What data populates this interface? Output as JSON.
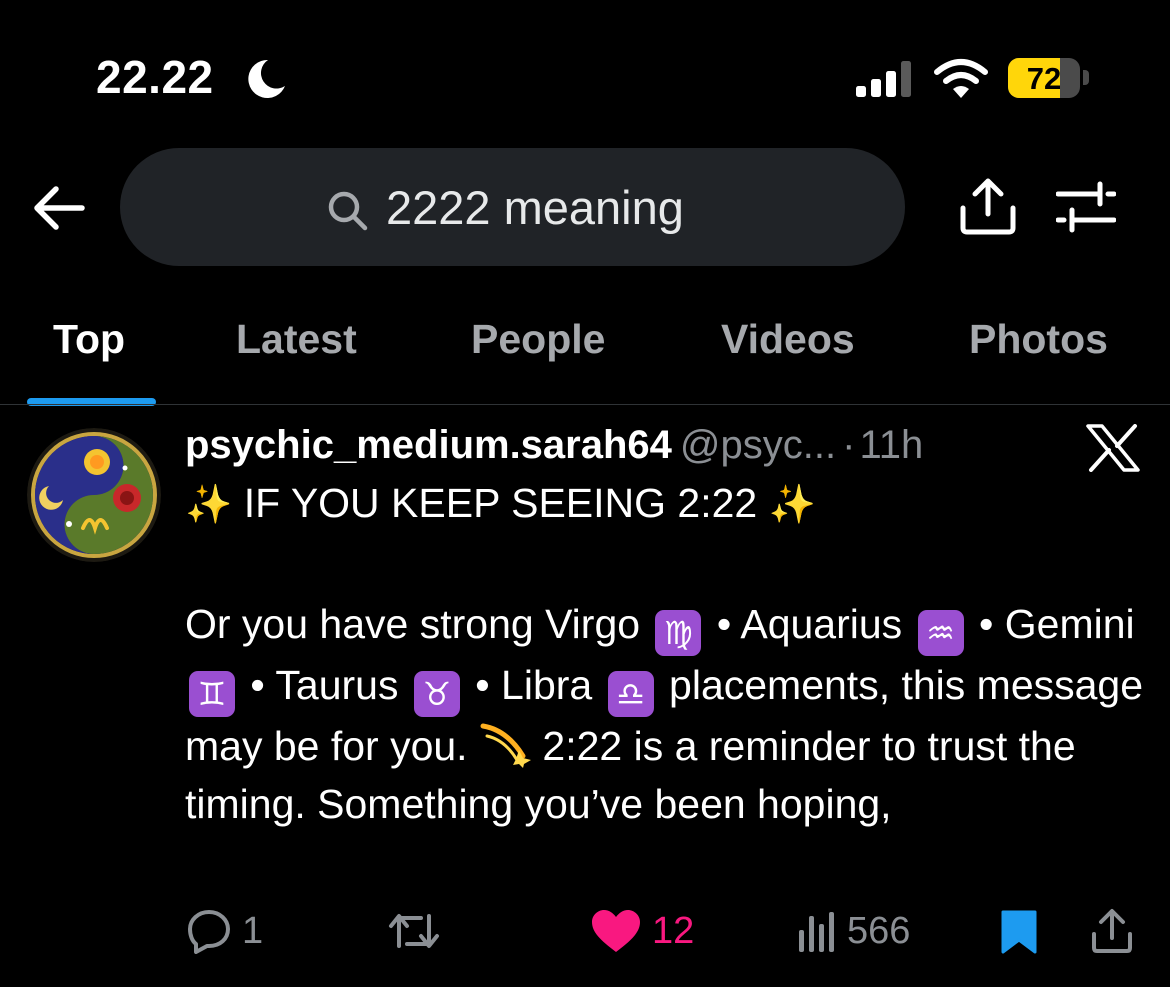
{
  "status_bar": {
    "time": "22.22",
    "battery": "72",
    "battery_level": 0.72,
    "icons": [
      "moon-icon",
      "signal-icon",
      "wifi-icon",
      "battery-icon"
    ]
  },
  "search": {
    "query": "2222 meaning",
    "icons": [
      "back-arrow-icon",
      "search-icon",
      "share-icon",
      "filter-icon"
    ]
  },
  "tabs": [
    {
      "label": "Top",
      "active": true
    },
    {
      "label": "Latest",
      "active": false
    },
    {
      "label": "People",
      "active": false
    },
    {
      "label": "Videos",
      "active": false
    },
    {
      "label": "Photos",
      "active": false
    }
  ],
  "tweet": {
    "author_name": "psychic_medium.sarah64",
    "author_handle": "@psyc...",
    "separator": "·",
    "time": "11h",
    "title_sparkle": "✨",
    "title": "IF YOU KEEP SEEING 2:22",
    "body": {
      "part1": "Or you have strong Virgo",
      "virgo": "♍",
      "sep1": "• Aquarius",
      "aquarius": "♒",
      "sep2": "•",
      "gemini_label": "Gemini",
      "gemini": "♊",
      "sep3": "• Taurus",
      "taurus": "♉",
      "sep4": "• Libra",
      "libra": "♎",
      "part2": "placements, this message may be for you.",
      "part3": "2:22 is a reminder to trust the timing. Something you’ve been hoping,"
    },
    "actions": {
      "replies": "1",
      "likes": "12",
      "views": "566"
    }
  },
  "colors": {
    "background": "#000000",
    "search_bg": "#202327",
    "muted_text": "#8b8f94",
    "like": "#f91880",
    "bookmark": "#1d9bf0",
    "zodiac_bg": "#9a4fd1",
    "battery": "#ffd60a"
  }
}
